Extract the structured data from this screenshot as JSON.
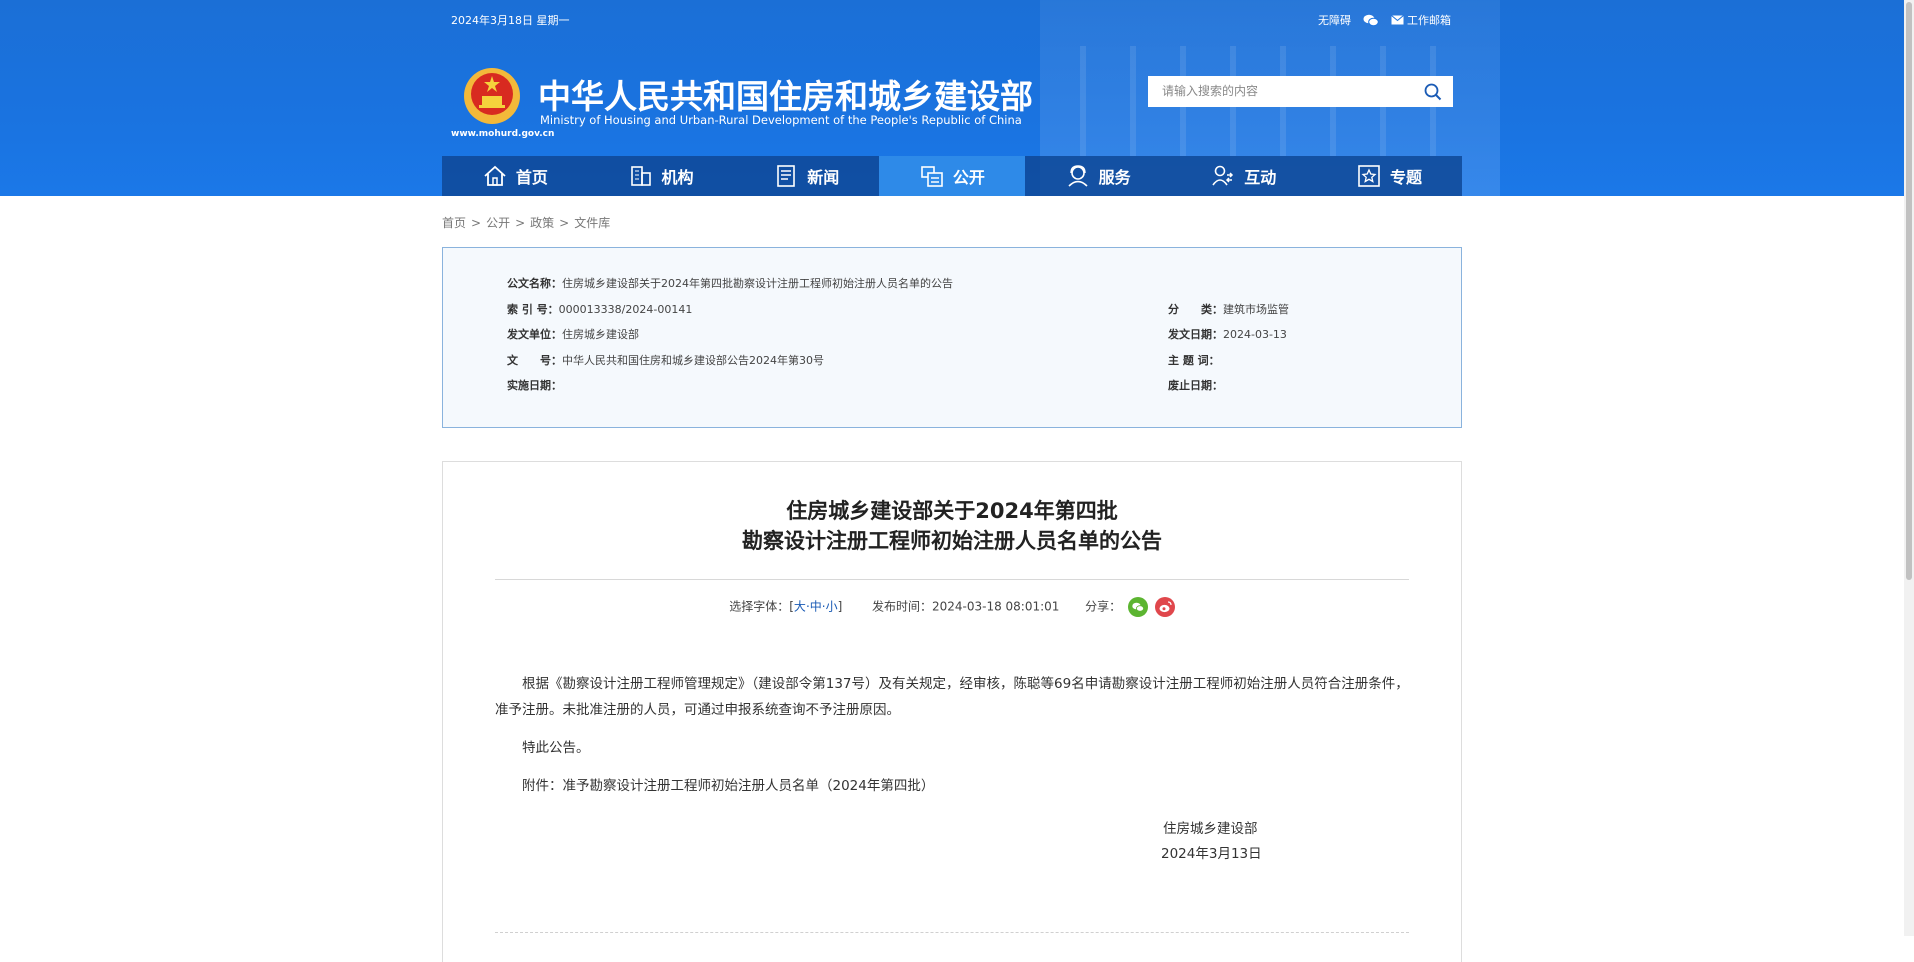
{
  "header": {
    "date": "2024年3月18日 星期一",
    "accessibility": "无障碍",
    "wechat_icon": "wechat-icon",
    "mail_label": "工作邮箱",
    "title_cn": "中华人民共和国住房和城乡建设部",
    "title_en": "Ministry of Housing and Urban-Rural Development of the People's Republic of China",
    "site_url": "www.mohurd.gov.cn",
    "search_placeholder": "请输入搜索的内容",
    "colors": {
      "header_bg": "#1a73e0",
      "nav_bg": "#0e4896",
      "nav_active": "#2e8ae8"
    }
  },
  "nav": [
    {
      "label": "首页",
      "icon": "home-icon"
    },
    {
      "label": "机构",
      "icon": "building-icon"
    },
    {
      "label": "新闻",
      "icon": "news-icon"
    },
    {
      "label": "公开",
      "icon": "open-icon",
      "active": true
    },
    {
      "label": "服务",
      "icon": "service-icon"
    },
    {
      "label": "互动",
      "icon": "interact-icon"
    },
    {
      "label": "专题",
      "icon": "topic-icon"
    }
  ],
  "breadcrumb": [
    "首页",
    ">",
    "公开",
    ">",
    "政策",
    ">",
    "文件库"
  ],
  "meta": {
    "doc_name_label": "公文名称：",
    "doc_name": "住房城乡建设部关于2024年第四批勘察设计注册工程师初始注册人员名单的公告",
    "index_label": "索 引 号：",
    "index": "000013338/2024-00141",
    "category_label": "分　　类：",
    "category": "建筑市场监管",
    "issuer_label": "发文单位：",
    "issuer": "住房城乡建设部",
    "issue_date_label": "发文日期：",
    "issue_date": "2024-03-13",
    "doc_no_label": "文　　号：",
    "doc_no": "中华人民共和国住房和城乡建设部公告2024年第30号",
    "keywords_label": "主 题 词：",
    "keywords": "",
    "effective_label": "实施日期：",
    "effective": "",
    "expire_label": "废止日期：",
    "expire": ""
  },
  "article": {
    "title_line1": "住房城乡建设部关于2024年第四批",
    "title_line2": "勘察设计注册工程师初始注册人员名单的公告",
    "font_label": "选择字体：[",
    "font_large": "大",
    "font_medium": "中",
    "font_small": "小",
    "font_close": "]",
    "sep": "·",
    "publish_label": "发布时间：",
    "publish_time": "2024-03-18 08:01:01",
    "share_label": "分享：",
    "body1": "根据《勘察设计注册工程师管理规定》（建设部令第137号）及有关规定，经审核，陈聪等69名申请勘察设计注册工程师初始注册人员符合注册条件，准予注册。未批准注册的人员，可通过申报系统查询不予注册原因。",
    "body2": "特此公告。",
    "attachment": "附件：准予勘察设计注册工程师初始注册人员名单（2024年第四批）",
    "sign_org": "住房城乡建设部",
    "sign_date": "2024年3月13日"
  }
}
